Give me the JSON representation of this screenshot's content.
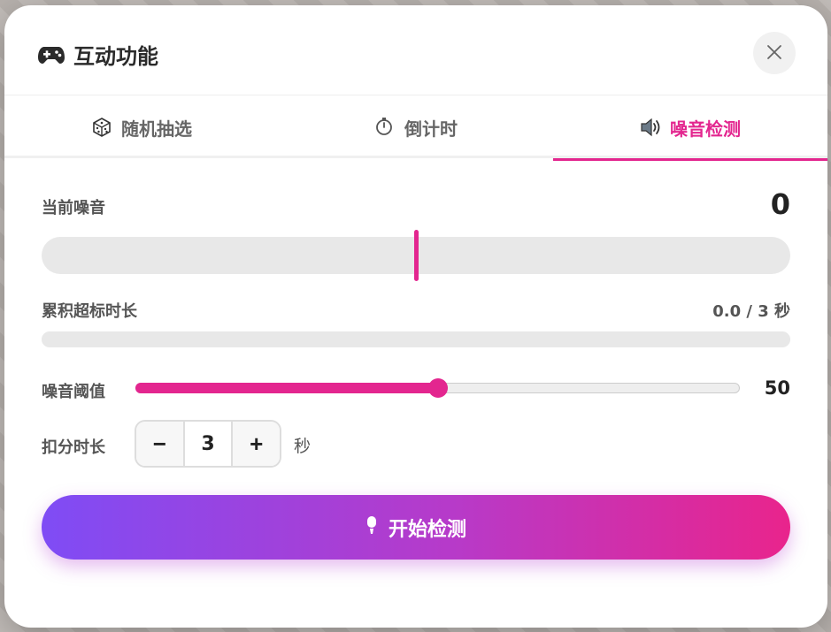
{
  "dialog": {
    "title": "互动功能",
    "title_icon": "gamepad-icon",
    "close_icon": "close-icon"
  },
  "tabs": [
    {
      "label": "随机抽选",
      "icon": "dice-icon",
      "active": false
    },
    {
      "label": "倒计时",
      "icon": "stopwatch-icon",
      "active": false
    },
    {
      "label": "噪音检测",
      "icon": "speaker-icon",
      "active": true
    }
  ],
  "noise": {
    "current_label": "当前噪音",
    "current_value": "0",
    "accum_label": "累积超标时长",
    "accum_value": "0.0 / 3 秒",
    "accum_progress": 0,
    "threshold_label": "噪音阈值",
    "threshold_value": "50",
    "threshold_fraction": 0.5,
    "penalty_label": "扣分时长",
    "penalty_value": "3",
    "penalty_unit": "秒",
    "decrement_label": "−",
    "increment_label": "+",
    "start_label": "开始检测",
    "start_icon": "microphone-icon"
  },
  "colors": {
    "accent": "#e3268f",
    "gradient_start": "#7f4cf5",
    "gradient_end": "#e9248c"
  }
}
